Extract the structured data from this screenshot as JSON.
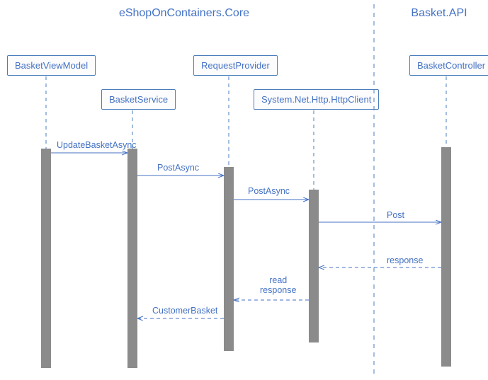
{
  "colors": {
    "accent": "#4472c4",
    "box_border": "#4a7ebb",
    "box_fill": "#fcfcfd",
    "bar": "#8b8b8b",
    "divider": "#4a7ebb"
  },
  "groups": {
    "left": {
      "label": "eShopOnContainers.Core"
    },
    "right": {
      "label": "Basket.API"
    }
  },
  "participants": {
    "viewmodel": {
      "label": "BasketViewModel"
    },
    "service": {
      "label": "BasketService"
    },
    "provider": {
      "label": "RequestProvider"
    },
    "httpclient": {
      "label": "System.Net.Http.HttpClient"
    },
    "controller": {
      "label": "BasketController"
    }
  },
  "messages": {
    "update": {
      "label": "UpdateBasketAsync"
    },
    "post1": {
      "label": "PostAsync"
    },
    "post2": {
      "label": "PostAsync"
    },
    "post3": {
      "label": "Post"
    },
    "resp": {
      "label": "response"
    },
    "readresp": {
      "label": "read\nresponse"
    },
    "custbasket": {
      "label": "CustomerBasket"
    }
  },
  "chart_data": {
    "type": "sequence-diagram",
    "groups": [
      {
        "name": "eShopOnContainers.Core",
        "participants": [
          "BasketViewModel",
          "BasketService",
          "RequestProvider",
          "System.Net.Http.HttpClient"
        ]
      },
      {
        "name": "Basket.API",
        "participants": [
          "BasketController"
        ]
      }
    ],
    "messages": [
      {
        "from": "BasketViewModel",
        "to": "BasketService",
        "label": "UpdateBasketAsync",
        "direction": "call"
      },
      {
        "from": "BasketService",
        "to": "RequestProvider",
        "label": "PostAsync",
        "direction": "call"
      },
      {
        "from": "RequestProvider",
        "to": "System.Net.Http.HttpClient",
        "label": "PostAsync",
        "direction": "call"
      },
      {
        "from": "System.Net.Http.HttpClient",
        "to": "BasketController",
        "label": "Post",
        "direction": "call"
      },
      {
        "from": "BasketController",
        "to": "System.Net.Http.HttpClient",
        "label": "response",
        "direction": "return"
      },
      {
        "from": "System.Net.Http.HttpClient",
        "to": "RequestProvider",
        "label": "read response",
        "direction": "return"
      },
      {
        "from": "RequestProvider",
        "to": "BasketService",
        "label": "CustomerBasket",
        "direction": "return"
      }
    ]
  }
}
